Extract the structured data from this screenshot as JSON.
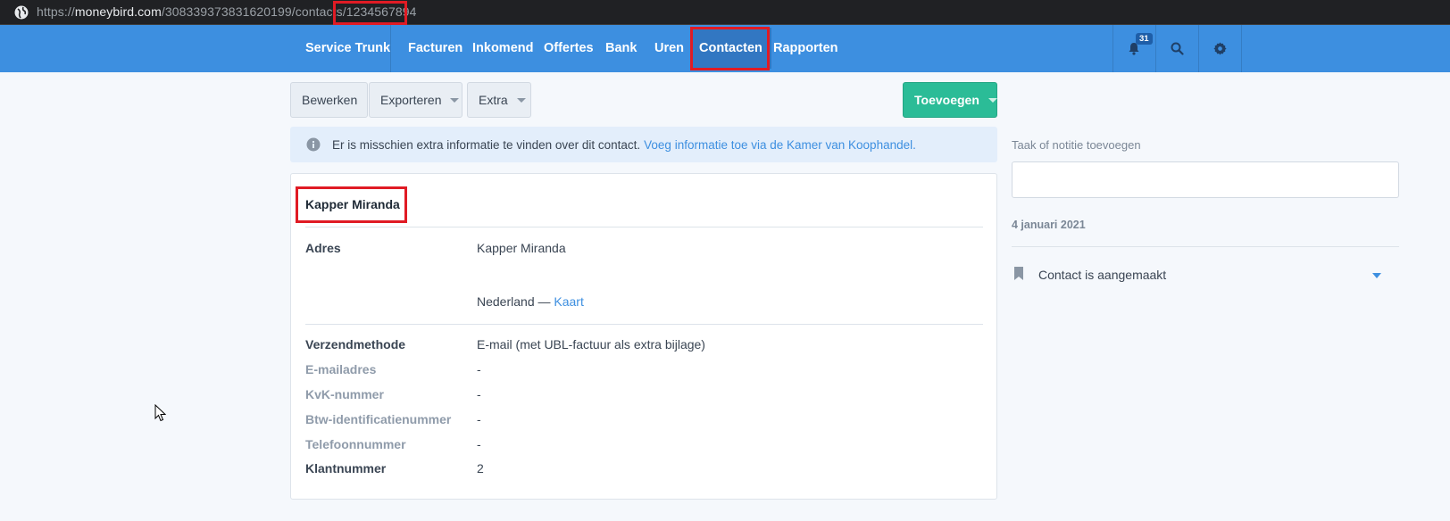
{
  "browser": {
    "url_scheme": "https://",
    "url_host": "moneybird.com",
    "url_path": "/308339373831620199/contacts/",
    "url_id": "1234567894"
  },
  "navbar": {
    "brand": "Service Trunk",
    "items": [
      "Facturen",
      "Inkomend",
      "Offertes",
      "Bank",
      "Uren",
      "Contacten",
      "Rapporten"
    ],
    "active": "Contacten",
    "notification_count": "31",
    "icons": [
      "bell-icon",
      "search-icon",
      "gear-icon"
    ]
  },
  "toolbar": {
    "edit_label": "Bewerken",
    "export_label": "Exporteren",
    "extra_label": "Extra",
    "add_label": "Toevoegen"
  },
  "alert": {
    "text": "Er is misschien extra informatie te vinden over dit contact.",
    "link": "Voeg informatie toe via de Kamer van Koophandel."
  },
  "contact": {
    "name": "Kapper Miranda",
    "address_label": "Adres",
    "address_line1": "Kapper Miranda",
    "country": "Nederland —",
    "map_link": "Kaart",
    "fields": [
      {
        "label": "Verzendmethode",
        "value": "E-mail (met UBL-factuur als extra bijlage)",
        "faded": false
      },
      {
        "label": "E-mailadres",
        "value": "-",
        "faded": true
      },
      {
        "label": "KvK-nummer",
        "value": "-",
        "faded": true
      },
      {
        "label": "Btw-identificatienummer",
        "value": "-",
        "faded": true
      },
      {
        "label": "Telefoonnummer",
        "value": "-",
        "faded": true
      },
      {
        "label": "Klantnummer",
        "value": "2",
        "faded": false
      }
    ]
  },
  "sidebar": {
    "note_label": "Taak of notitie toevoegen",
    "note_placeholder": "",
    "date": "4 januari 2021",
    "event": "Contact is aangemaakt"
  },
  "colors": {
    "navbar": "#3d8fe0",
    "active_nav": "#3277c2",
    "primary_button": "#2bbc97",
    "highlight": "#e01b24",
    "link": "#3d8fe0"
  }
}
